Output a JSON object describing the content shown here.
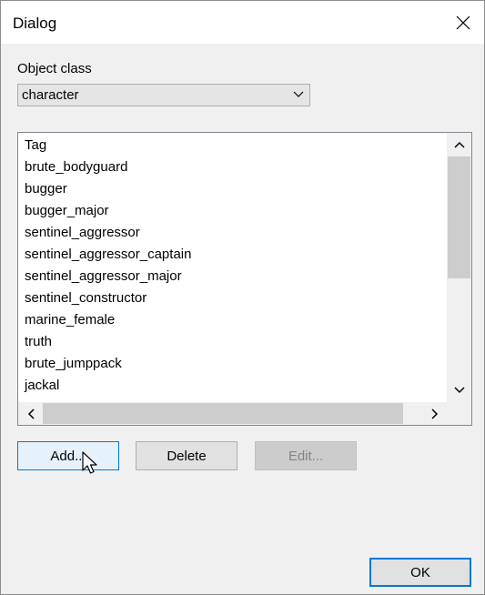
{
  "window": {
    "title": "Dialog",
    "close_icon": "close-icon"
  },
  "object_class": {
    "label": "Object class",
    "selected": "character"
  },
  "tag_list": {
    "items": [
      "Tag",
      "brute_bodyguard",
      "bugger",
      "bugger_major",
      "sentinel_aggressor",
      "sentinel_aggressor_captain",
      "sentinel_aggressor_major",
      "sentinel_constructor",
      "marine_female",
      "truth",
      "brute_jumppack",
      "jackal"
    ]
  },
  "buttons": {
    "add": "Add...",
    "delete": "Delete",
    "edit": "Edit...",
    "ok": "OK"
  },
  "colors": {
    "accent": "#0078d7",
    "dialog_bg": "#f0f0f0"
  }
}
